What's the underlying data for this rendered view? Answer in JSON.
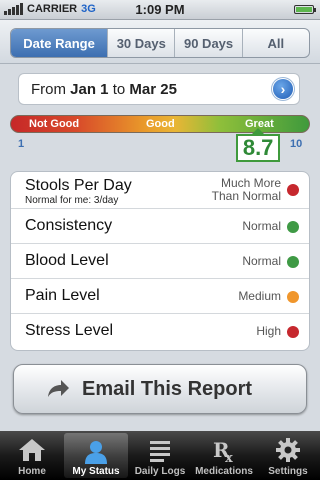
{
  "status_bar": {
    "carrier": "CARRIER",
    "network": "3G",
    "time": "1:09 PM"
  },
  "range_tabs": {
    "items": [
      "Date Range",
      "30 Days",
      "90 Days",
      "All"
    ],
    "selected": "Date Range"
  },
  "date_range": {
    "prefix": "From",
    "start": "Jan 1",
    "connector": "to",
    "end": "Mar 25"
  },
  "gauge": {
    "labels": [
      "Not Good",
      "Good",
      "Great"
    ],
    "min": "1",
    "max": "10",
    "score": 8.7,
    "score_label": "8.7",
    "colors": {
      "bad": "#c62828",
      "medium": "#e9a52a",
      "great": "#3f9a3c"
    }
  },
  "metrics": [
    {
      "label": "Stools Per Day",
      "sublabel": "Normal for me: 3/day",
      "status_line1": "Much More",
      "status_line2": "Than Normal",
      "color": "#c6282e"
    },
    {
      "label": "Consistency",
      "status": "Normal",
      "color": "#3f9a45"
    },
    {
      "label": "Blood Level",
      "status": "Normal",
      "color": "#3f9a45"
    },
    {
      "label": "Pain Level",
      "status": "Medium",
      "color": "#f0962c"
    },
    {
      "label": "Stress Level",
      "status": "High",
      "color": "#c6282e"
    }
  ],
  "email_button": {
    "label": "Email This Report",
    "icon": "share-arrow-icon"
  },
  "tab_bar": {
    "items": [
      {
        "label": "Home",
        "icon": "home-icon"
      },
      {
        "label": "My Status",
        "icon": "person-icon"
      },
      {
        "label": "Daily Logs",
        "icon": "list-icon"
      },
      {
        "label": "Medications",
        "icon": "rx-icon"
      },
      {
        "label": "Settings",
        "icon": "gear-icon"
      }
    ],
    "selected": "My Status"
  }
}
